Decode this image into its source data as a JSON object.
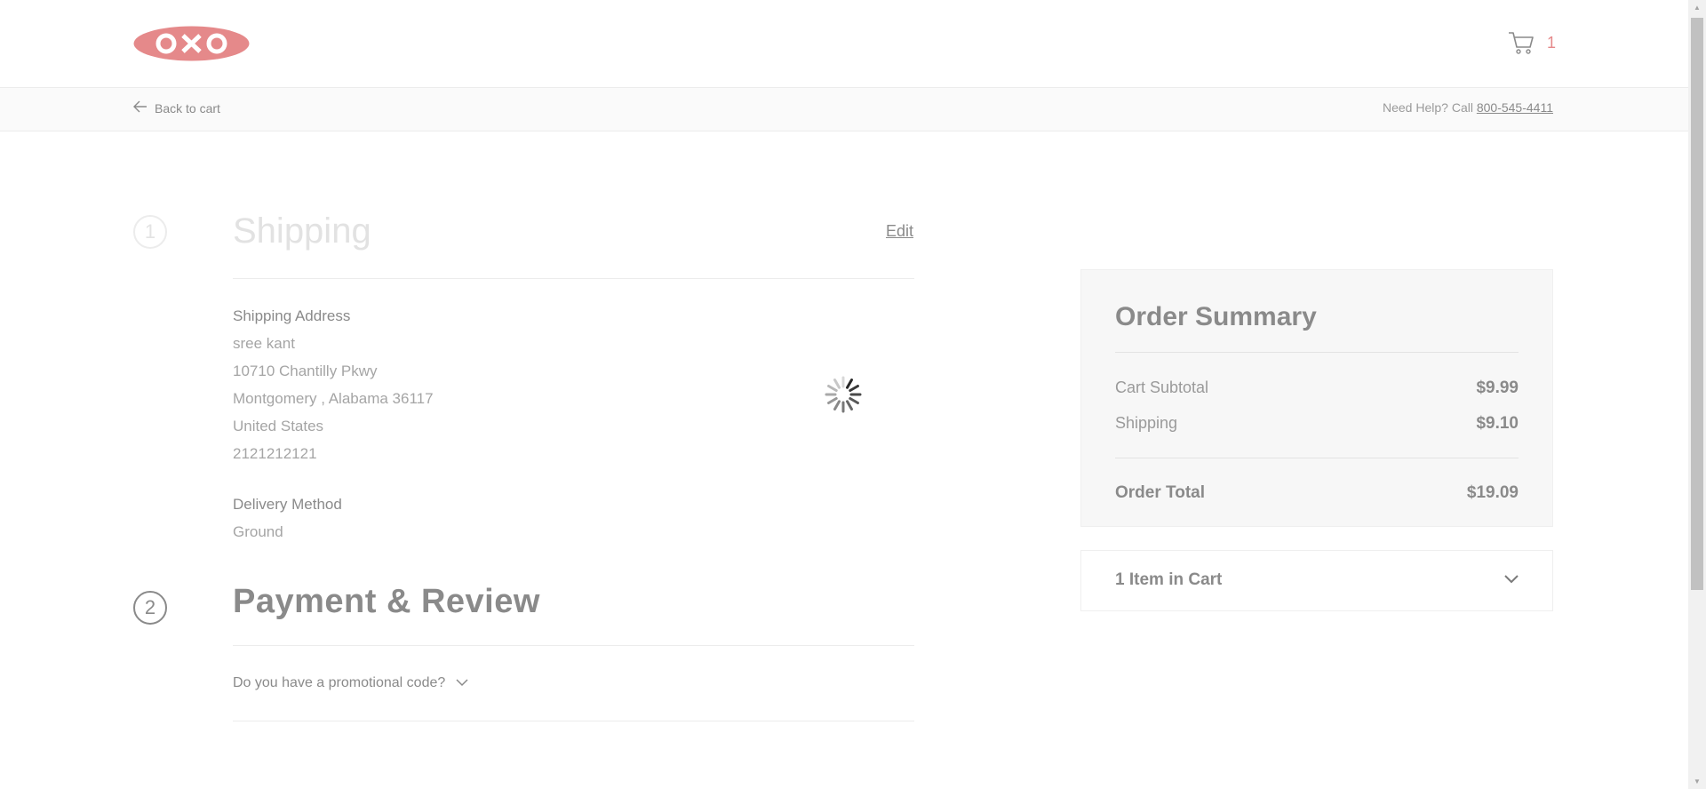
{
  "header": {
    "logo_text": "OXO",
    "brand_color": "#e5898a",
    "cart_count": "1"
  },
  "subbar": {
    "back_label": "Back to cart",
    "help_prefix": "Need Help? Call ",
    "help_phone": "800-545-4411"
  },
  "shipping": {
    "step_number": "1",
    "title": "Shipping",
    "edit_label": "Edit",
    "address_label": "Shipping Address",
    "address_lines": [
      "sree kant",
      "10710 Chantilly Pkwy",
      "Montgomery , Alabama 36117",
      "United States",
      "2121212121"
    ],
    "delivery_label": "Delivery Method",
    "delivery_value": "Ground"
  },
  "payment": {
    "step_number": "2",
    "title": "Payment & Review",
    "promo_label": "Do you have a promotional code?"
  },
  "summary": {
    "title": "Order Summary",
    "subtotal_label": "Cart Subtotal",
    "subtotal_value": "$9.99",
    "shipping_label": "Shipping",
    "shipping_value": "$9.10",
    "total_label": "Order Total",
    "total_value": "$19.09",
    "items_label": "1 Item in Cart"
  }
}
